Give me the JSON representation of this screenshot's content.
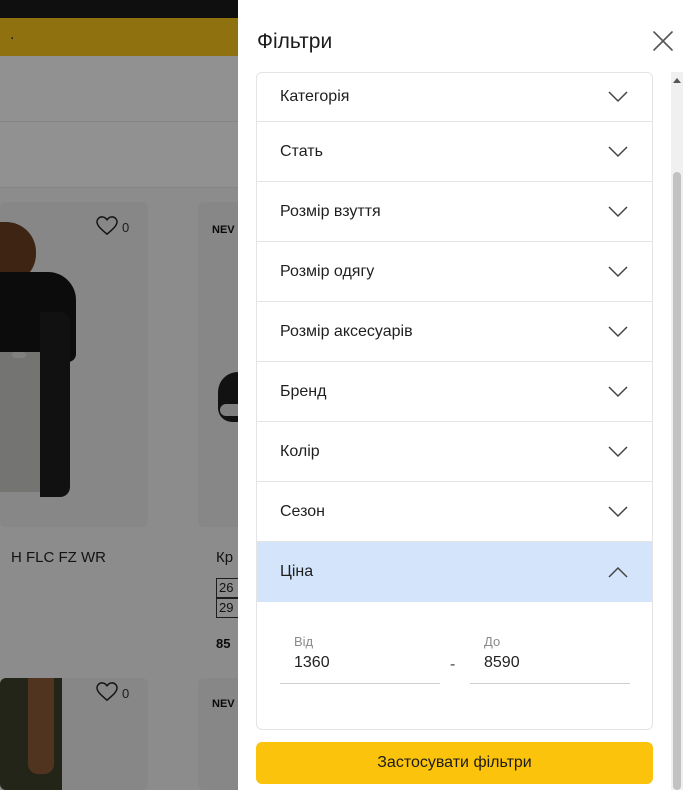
{
  "background": {
    "products": [
      {
        "likes": "0",
        "name": "H FLC FZ WR"
      },
      {
        "badge": "NEV",
        "name": "Кр",
        "sizes": [
          "26",
          "29"
        ],
        "price": "85"
      },
      {
        "likes": "0"
      },
      {
        "badge": "NEV"
      }
    ]
  },
  "filters": {
    "title": "Фільтри",
    "items": [
      {
        "label": "Категорія"
      },
      {
        "label": "Стать"
      },
      {
        "label": "Розмір взуття"
      },
      {
        "label": "Розмір одягу"
      },
      {
        "label": "Розмір аксесуарів"
      },
      {
        "label": "Бренд"
      },
      {
        "label": "Колір"
      },
      {
        "label": "Сезон"
      },
      {
        "label": "Ціна",
        "expanded": true
      }
    ],
    "price": {
      "from_label": "Від",
      "from_value": "1360",
      "to_label": "До",
      "to_value": "8590",
      "separator": "-"
    },
    "apply_label": "Застосувати фільтри"
  },
  "colors": {
    "accent": "#fcc30c",
    "active_row": "#d3e4fb",
    "promo_bar": "#f7c41a"
  },
  "icons": [
    "close-icon",
    "chevron-down-icon",
    "chevron-up-icon",
    "heart-icon"
  ]
}
